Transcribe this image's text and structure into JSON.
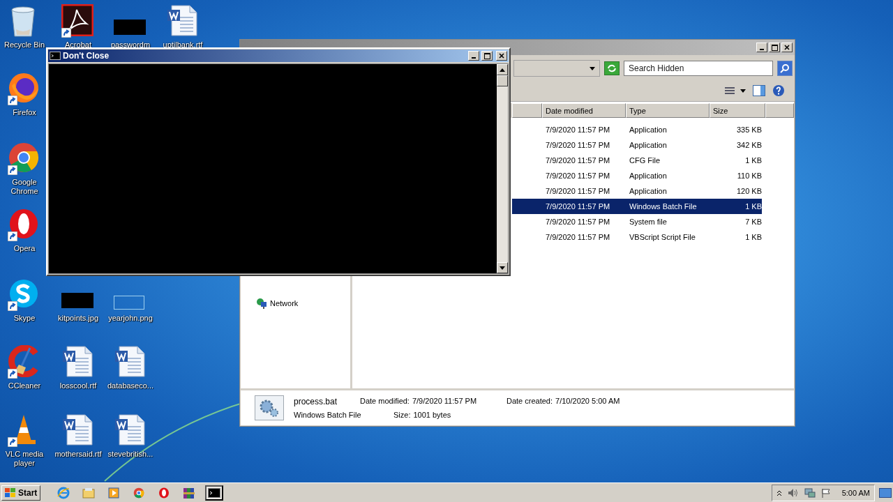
{
  "desktop": {
    "icons": [
      {
        "label": "Recycle Bin",
        "kind": "recycle",
        "shortcut": false
      },
      {
        "label": "Acrobat",
        "kind": "acrobat",
        "shortcut": true
      },
      {
        "label": "passwordm",
        "kind": "dark-thumbnail",
        "shortcut": false
      },
      {
        "label": "uptilbank.rtf",
        "kind": "word",
        "shortcut": false
      },
      {
        "label": "Firefox",
        "kind": "firefox",
        "shortcut": true
      },
      {
        "label": "Google Chrome",
        "kind": "chrome",
        "shortcut": true
      },
      {
        "label": "Opera",
        "kind": "opera",
        "shortcut": true
      },
      {
        "label": "Skype",
        "kind": "skype",
        "shortcut": true
      },
      {
        "label": "kitpoints.jpg",
        "kind": "dark-thumbnail",
        "shortcut": false
      },
      {
        "label": "yearjohn.png",
        "kind": "light-thumbnail",
        "shortcut": false
      },
      {
        "label": "CCleaner",
        "kind": "ccleaner",
        "shortcut": true
      },
      {
        "label": "losscool.rtf",
        "kind": "word",
        "shortcut": false
      },
      {
        "label": "databaseco...",
        "kind": "word",
        "shortcut": false
      },
      {
        "label": "VLC media player",
        "kind": "vlc",
        "shortcut": true
      },
      {
        "label": "mothersaid.rtf",
        "kind": "word",
        "shortcut": false
      },
      {
        "label": "stevebritish...",
        "kind": "word",
        "shortcut": false
      }
    ]
  },
  "explorer": {
    "search": {
      "placeholder": "Search Hidden"
    },
    "columns": [
      "Date modified",
      "Type",
      "Size"
    ],
    "rows": [
      {
        "date": "7/9/2020 11:57 PM",
        "type": "Application",
        "size": "335 KB",
        "selected": false
      },
      {
        "date": "7/9/2020 11:57 PM",
        "type": "Application",
        "size": "342 KB",
        "selected": false
      },
      {
        "date": "7/9/2020 11:57 PM",
        "type": "CFG File",
        "size": "1 KB",
        "selected": false
      },
      {
        "date": "7/9/2020 11:57 PM",
        "type": "Application",
        "size": "110 KB",
        "selected": false
      },
      {
        "date": "7/9/2020 11:57 PM",
        "type": "Application",
        "size": "120 KB",
        "selected": false
      },
      {
        "date": "7/9/2020 11:57 PM",
        "type": "Windows Batch File",
        "size": "1 KB",
        "selected": true
      },
      {
        "date": "7/9/2020 11:57 PM",
        "type": "System file",
        "size": "7 KB",
        "selected": false
      },
      {
        "date": "7/9/2020 11:57 PM",
        "type": "VBScript Script File",
        "size": "1 KB",
        "selected": false
      }
    ],
    "nav": [
      {
        "label": "Network"
      }
    ],
    "details": {
      "name": "process.bat",
      "type": "Windows Batch File",
      "modified_label": "Date modified:",
      "modified": "7/9/2020 11:57 PM",
      "size_label": "Size:",
      "size": "1001 bytes",
      "created_label": "Date created:",
      "created": "7/10/2020 5:00 AM"
    }
  },
  "console": {
    "title": "Don't Close"
  },
  "taskbar": {
    "start": "Start",
    "apps": [
      {
        "kind": "ie",
        "selected": false
      },
      {
        "kind": "explorer",
        "selected": false
      },
      {
        "kind": "media",
        "selected": false
      },
      {
        "kind": "chrome",
        "selected": false
      },
      {
        "kind": "opera",
        "selected": false
      },
      {
        "kind": "winrar",
        "selected": false
      },
      {
        "kind": "cmd",
        "selected": true
      }
    ],
    "time": "5:00 AM"
  }
}
